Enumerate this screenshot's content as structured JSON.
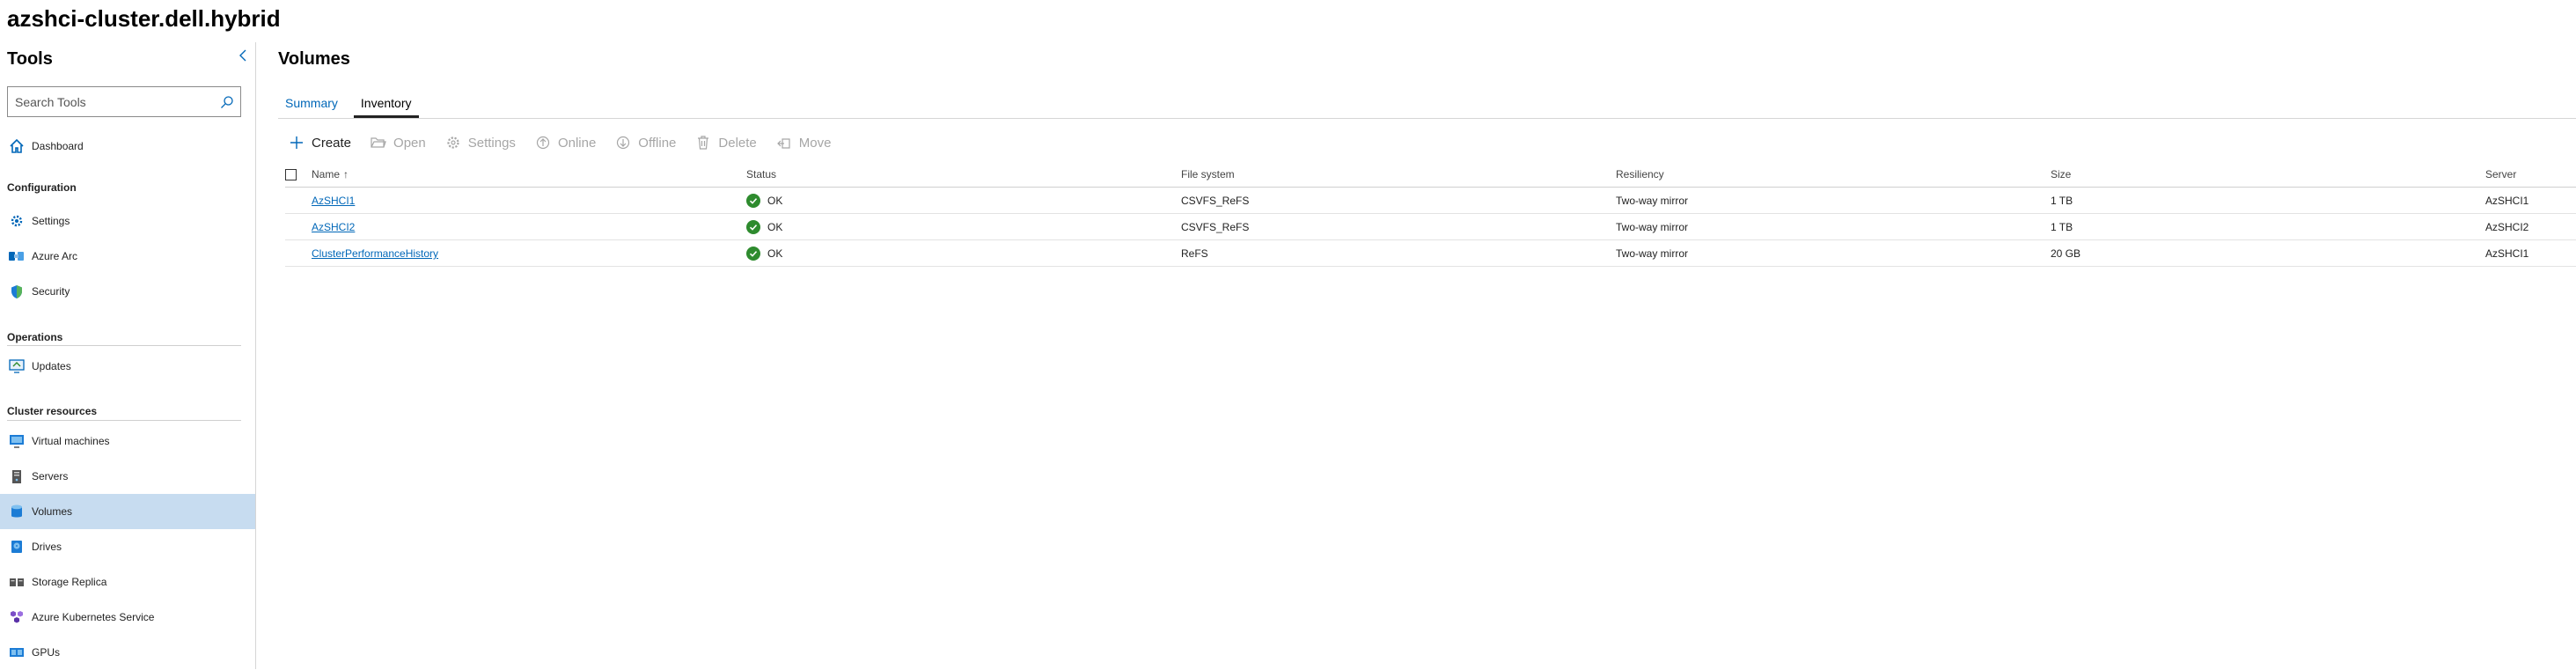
{
  "cluster_title": "azshci-cluster.dell.hybrid",
  "sidebar": {
    "title": "Tools",
    "search_placeholder": "Search Tools",
    "dashboard_label": "Dashboard",
    "sections": {
      "configuration": "Configuration",
      "operations": "Operations",
      "cluster_resources": "Cluster resources"
    },
    "configuration_items": [
      "Settings",
      "Azure Arc",
      "Security"
    ],
    "operations_items": [
      "Updates"
    ],
    "cluster_items": [
      "Virtual machines",
      "Servers",
      "Volumes",
      "Drives",
      "Storage Replica",
      "Azure Kubernetes Service",
      "GPUs"
    ],
    "active_item": "Volumes"
  },
  "main": {
    "title": "Volumes",
    "tabs": [
      "Summary",
      "Inventory"
    ],
    "active_tab": "Inventory",
    "toolbar": [
      "Create",
      "Open",
      "Settings",
      "Online",
      "Offline",
      "Delete",
      "Move"
    ],
    "columns": [
      "Name",
      "Status",
      "File system",
      "Resiliency",
      "Size",
      "Server"
    ],
    "sort_indicator": "↑",
    "rows": [
      {
        "name": "AzSHCI1",
        "status": "OK",
        "fs": "CSVFS_ReFS",
        "resiliency": "Two-way mirror",
        "size": "1 TB",
        "server": "AzSHCI1"
      },
      {
        "name": "AzSHCI2",
        "status": "OK",
        "fs": "CSVFS_ReFS",
        "resiliency": "Two-way mirror",
        "size": "1 TB",
        "server": "AzSHCI2"
      },
      {
        "name": "ClusterPerformanceHistory",
        "status": "OK",
        "fs": "ReFS",
        "resiliency": "Two-way mirror",
        "size": "20 GB",
        "server": "AzSHCI1"
      }
    ]
  },
  "colors": {
    "accent": "#0067b8",
    "active_nav": "#c7dcf0",
    "ok_green": "#2e8b2e",
    "disabled": "#a6a6a6"
  }
}
